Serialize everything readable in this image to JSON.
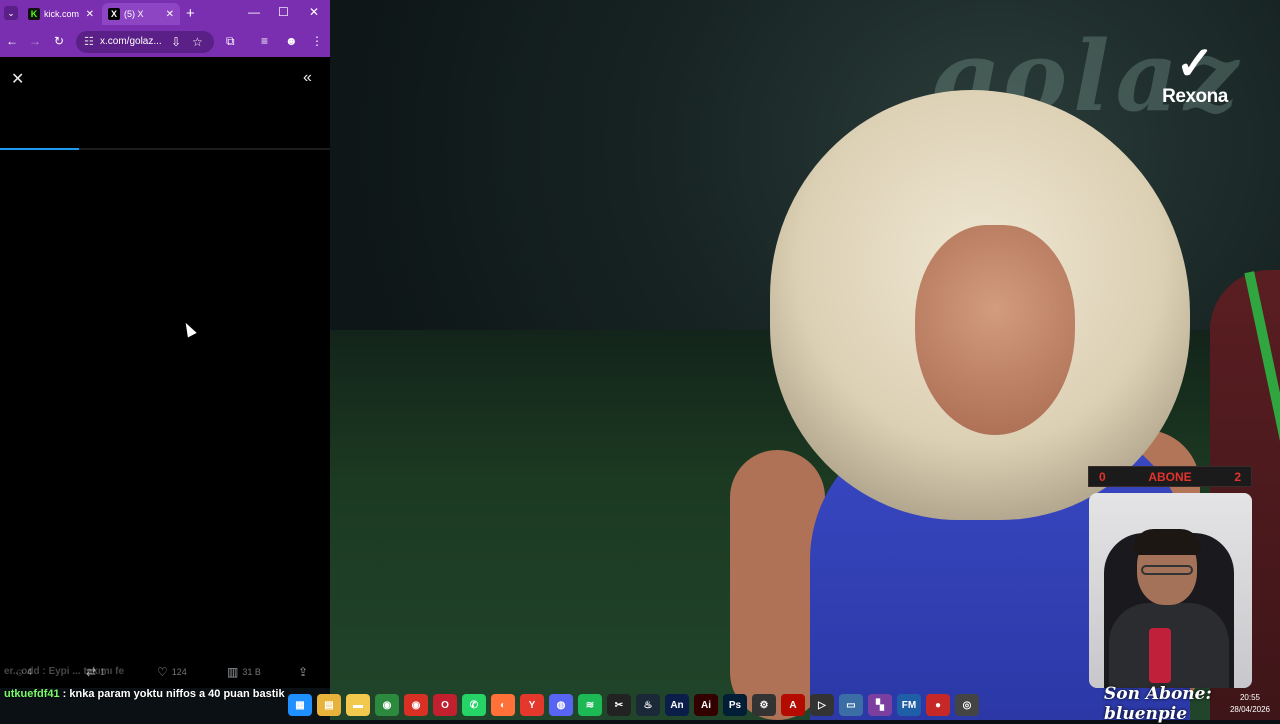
{
  "browser": {
    "tabs": [
      {
        "label": "kick.com",
        "favicon": "K"
      },
      {
        "label": "(5) X",
        "favicon": "X"
      }
    ],
    "new_tab": "+",
    "window_controls": {
      "minimize": "—",
      "maximize": "☐",
      "close": "✕"
    },
    "url": "x.com/golaz...",
    "theme_color": "#7a2fb1"
  },
  "post": {
    "close": "✕",
    "collapse": "«",
    "load_progress": 0.24,
    "actions": {
      "replies": "4",
      "reposts": "1",
      "likes": "124",
      "views": "31 B"
    }
  },
  "chat": {
    "faded": "er...odd : Eypi ... takımı fe",
    "messages": [
      {
        "user": "utkuefdf41",
        "text": " : knka param yoktu niffos a 40 puan bastik"
      }
    ]
  },
  "stream": {
    "sponsor": "Rexona",
    "abone": {
      "left": "0",
      "label": "ABONE",
      "right": "2"
    },
    "son_abone": "Son Abone: bluenpie",
    "accent_color": "#e2332d"
  },
  "taskbar": {
    "apps": [
      {
        "name": "windows-start-icon",
        "glyph": "▦",
        "color": "#1e90ff"
      },
      {
        "name": "file-explorer-icon",
        "glyph": "▤",
        "color": "#e8b33b"
      },
      {
        "name": "folder-icon",
        "glyph": "▬",
        "color": "#f2c94c"
      },
      {
        "name": "chrome-icon",
        "glyph": "◉",
        "color": "#2b8a3e"
      },
      {
        "name": "chrome-alt-icon",
        "glyph": "◉",
        "color": "#d93025"
      },
      {
        "name": "opera-icon",
        "glyph": "O",
        "color": "#c2202f"
      },
      {
        "name": "whatsapp-icon",
        "glyph": "✆",
        "color": "#25d366"
      },
      {
        "name": "firefox-icon",
        "glyph": "◐",
        "color": "#ff7139"
      },
      {
        "name": "yandex-icon",
        "glyph": "Y",
        "color": "#e4382d"
      },
      {
        "name": "discord-icon",
        "glyph": "◍",
        "color": "#5865f2"
      },
      {
        "name": "spotify-icon",
        "glyph": "≋",
        "color": "#1db954"
      },
      {
        "name": "capcut-icon",
        "glyph": "✂",
        "color": "#222222"
      },
      {
        "name": "steam-icon",
        "glyph": "♨",
        "color": "#1b2838"
      },
      {
        "name": "animate-icon",
        "glyph": "An",
        "color": "#0b1e4a"
      },
      {
        "name": "illustrator-icon",
        "glyph": "Ai",
        "color": "#330000"
      },
      {
        "name": "photoshop-icon",
        "glyph": "Ps",
        "color": "#001e36"
      },
      {
        "name": "settings-icon",
        "glyph": "⚙",
        "color": "#333333"
      },
      {
        "name": "acrobat-icon",
        "glyph": "A",
        "color": "#b30b00"
      },
      {
        "name": "video-icon",
        "glyph": "▷",
        "color": "#333333"
      },
      {
        "name": "monitor-icon",
        "glyph": "▭",
        "color": "#3a6ea5"
      },
      {
        "name": "media-icon",
        "glyph": "▚",
        "color": "#7b3fa0"
      },
      {
        "name": "fm-icon",
        "glyph": "FM",
        "color": "#1f5fa8"
      },
      {
        "name": "recorder-icon",
        "glyph": "●",
        "color": "#c62828"
      },
      {
        "name": "obs-icon",
        "glyph": "◎",
        "color": "#444444"
      }
    ],
    "time": "20:55",
    "date": "28/04/2026"
  }
}
